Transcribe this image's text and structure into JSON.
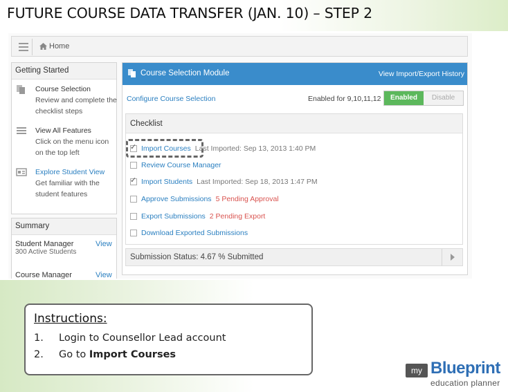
{
  "slide": {
    "title": "FUTURE COURSE DATA TRANSFER (JAN. 10) – STEP 2"
  },
  "topbar": {
    "home_label": "Home"
  },
  "getting_started": {
    "title": "Getting Started",
    "items": [
      {
        "title": "Course Selection",
        "desc": "Review and complete the checklist steps",
        "icon": "document-stack-icon"
      },
      {
        "title": "View All Features",
        "desc": "Click on the menu icon on the top left",
        "icon": "menu-icon"
      },
      {
        "title": "Explore Student View",
        "desc": "Get familiar with the student features",
        "icon": "id-card-icon"
      }
    ]
  },
  "summary": {
    "title": "Summary",
    "rows": [
      {
        "name": "Student Manager",
        "view": "View",
        "sub": "300 Active Students"
      },
      {
        "name": "Course Manager",
        "view": "View",
        "sub": ""
      }
    ]
  },
  "module": {
    "title": "Course Selection Module",
    "history_link": "View Import/Export History",
    "configure_link": "Configure Course Selection",
    "enabled_for": "Enabled for 9,10,11,12",
    "toggle_on": "Enabled",
    "toggle_off": "Disable",
    "checklist_title": "Checklist",
    "checklist": [
      {
        "label": "Import Courses",
        "note": "Last Imported: Sep 13, 2013 1:40 PM",
        "checked": true,
        "note_color": "gray"
      },
      {
        "label": "Review Course Manager",
        "note": "",
        "checked": false,
        "note_color": "gray"
      },
      {
        "label": "Import Students",
        "note": "Last Imported: Sep 18, 2013 1:47 PM",
        "checked": true,
        "note_color": "gray"
      },
      {
        "label": "Approve Submissions",
        "note": "5 Pending Approval",
        "checked": false,
        "note_color": "red"
      },
      {
        "label": "Export Submissions",
        "note": "2 Pending Export",
        "checked": false,
        "note_color": "red"
      },
      {
        "label": "Download Exported Submissions",
        "note": "",
        "checked": false,
        "note_color": "gray"
      }
    ],
    "status_text": "Submission Status: 4.67 % Submitted"
  },
  "instructions": {
    "title": "Instructions:",
    "steps": [
      {
        "num": "1.",
        "text": "Login to Counsellor Lead account",
        "bold": ""
      },
      {
        "num": "2.",
        "text": "Go to ",
        "bold": "Import Courses"
      }
    ]
  },
  "logo": {
    "my": "my",
    "brand": "Blueprint",
    "tagline": "education planner"
  },
  "colors": {
    "accent_blue": "#3a8ccb",
    "link_blue": "#2a7fc0",
    "enabled_green": "#5cb85c",
    "pending_red": "#d9534f"
  }
}
